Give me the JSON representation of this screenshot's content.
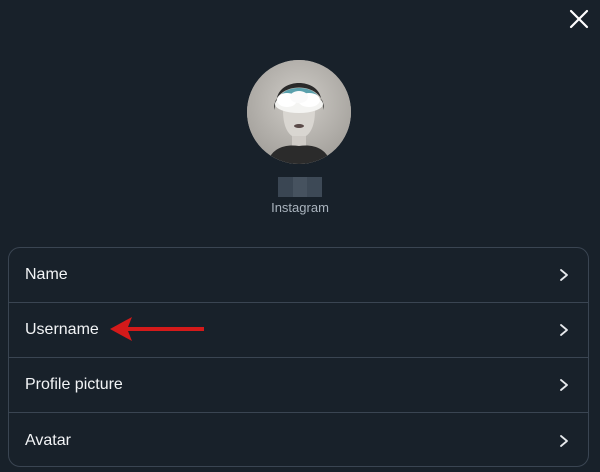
{
  "dialog": {
    "close_icon": "close-icon",
    "profile": {
      "avatar_alt": "profile-avatar",
      "account_source": "Instagram"
    },
    "settings_rows": [
      {
        "label": "Name",
        "icon": "chevron-right-icon"
      },
      {
        "label": "Username",
        "icon": "chevron-right-icon"
      },
      {
        "label": "Profile picture",
        "icon": "chevron-right-icon"
      },
      {
        "label": "Avatar",
        "icon": "chevron-right-icon"
      }
    ]
  },
  "annotation": {
    "arrow_color": "#d41a1a",
    "points_to": "Username"
  },
  "colors": {
    "background": "#18212a",
    "border": "#3a4552",
    "text_primary": "#f2f4f6",
    "text_secondary": "#a9b3bd"
  }
}
